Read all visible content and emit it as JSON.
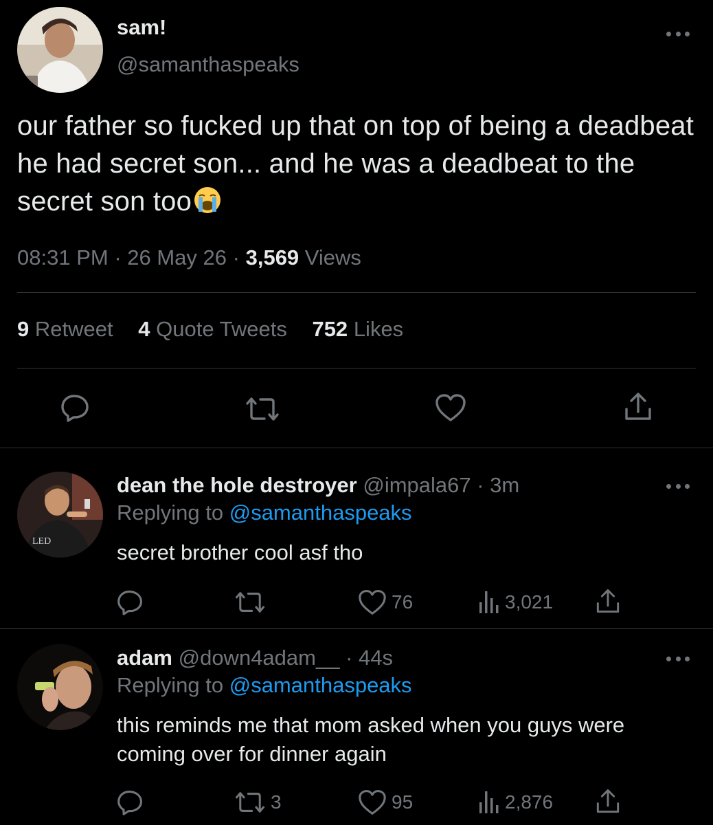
{
  "tweet": {
    "display_name": "sam!",
    "handle": "@samanthaspeaks",
    "text": "our father so fucked up that on top of being a deadbeat he had secret son... and he was a deadbeat to the secret son too",
    "time": "08:31 PM",
    "date": "26 May 26",
    "views_count": "3,569",
    "views_label": "Views",
    "retweets_count": "9",
    "retweets_label": "Retweet",
    "quotes_count": "4",
    "quotes_label": "Quote Tweets",
    "likes_count": "752",
    "likes_label": "Likes"
  },
  "replies": [
    {
      "display_name": "dean the hole destroyer",
      "handle": "@impala67",
      "age": "· 3m",
      "replying_prefix": "Replying to",
      "replying_to": "@samanthaspeaks",
      "text": "secret brother cool asf tho",
      "retweets": "",
      "likes": "76",
      "views": "3,021"
    },
    {
      "display_name": "adam",
      "handle": "@down4adam__",
      "age": "· 44s",
      "replying_prefix": "Replying to",
      "replying_to": "@samanthaspeaks",
      "text": "this reminds me that mom asked when you guys were coming over for dinner again",
      "retweets": "3",
      "likes": "95",
      "views": "2,876"
    }
  ],
  "icons": {
    "reply": "comment-bubble-icon",
    "retweet": "retweet-icon",
    "like": "heart-icon",
    "share": "share-icon",
    "views": "views-bar-chart-icon",
    "more": "more-options-icon",
    "emoji": "loudly-crying-face-emoji"
  },
  "colors": {
    "background": "#000000",
    "text": "#e7e9ea",
    "muted": "#71767b",
    "link": "#1d9bf0",
    "divider": "#2f3336"
  }
}
